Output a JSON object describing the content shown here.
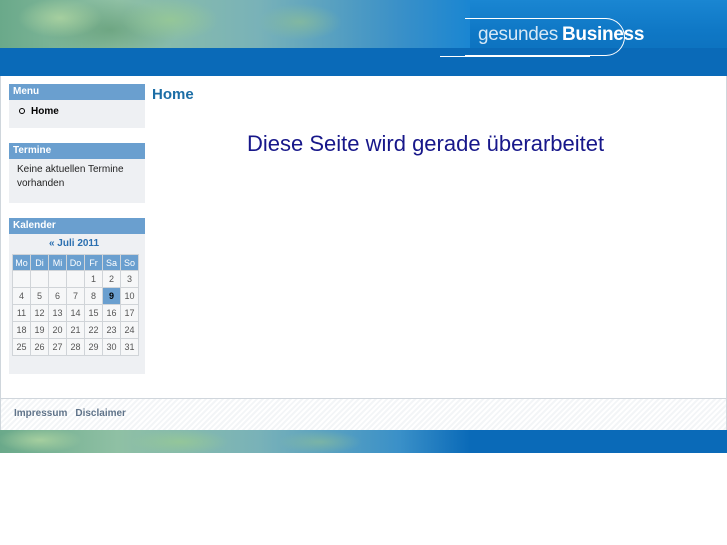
{
  "header": {
    "logo_light": "gesundes",
    "logo_bold": "Business"
  },
  "sidebar": {
    "menu": {
      "title": "Menu",
      "items": [
        {
          "label": "Home"
        }
      ]
    },
    "termine": {
      "title": "Termine",
      "text": "Keine aktuellen Termine vorhanden"
    },
    "kalender": {
      "title": "Kalender",
      "month_label": "« Juli 2011",
      "weekdays": [
        "Mo",
        "Di",
        "Mi",
        "Do",
        "Fr",
        "Sa",
        "So"
      ],
      "weeks": [
        [
          "",
          "",
          "",
          "",
          "1",
          "2",
          "3"
        ],
        [
          "4",
          "5",
          "6",
          "7",
          "8",
          "9",
          "10"
        ],
        [
          "11",
          "12",
          "13",
          "14",
          "15",
          "16",
          "17"
        ],
        [
          "18",
          "19",
          "20",
          "21",
          "22",
          "23",
          "24"
        ],
        [
          "25",
          "26",
          "27",
          "28",
          "29",
          "30",
          "31"
        ]
      ],
      "today": "9"
    }
  },
  "main": {
    "title": "Home",
    "notice": "Diese Seite wird gerade überarbeitet"
  },
  "footer": {
    "links": [
      "Impressum",
      "Disclaimer"
    ]
  },
  "colors": {
    "header_blue": "#0a6ab8",
    "box_title_blue": "#6a9fcf",
    "page_title": "#1c6ea6",
    "notice_text": "#17178a"
  }
}
